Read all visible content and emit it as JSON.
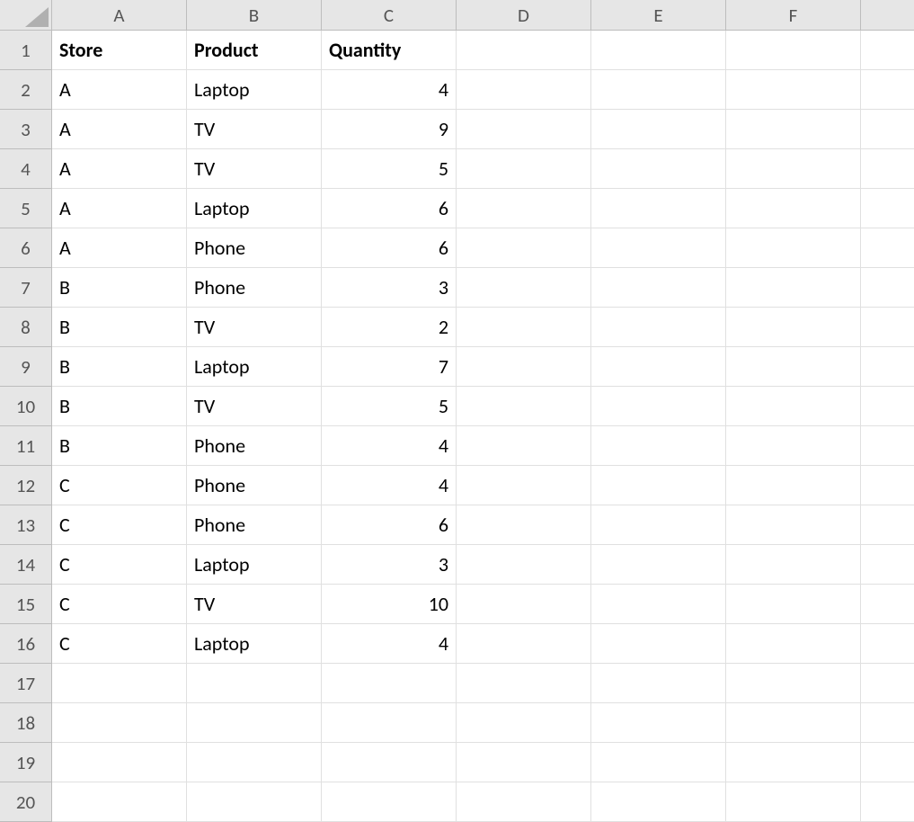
{
  "columns": [
    "A",
    "B",
    "C",
    "D",
    "E",
    "F",
    ""
  ],
  "rowCount": 20,
  "headers": {
    "A": "Store",
    "B": "Product",
    "C": "Quantity"
  },
  "rows": [
    {
      "store": "A",
      "product": "Laptop",
      "qty": "4"
    },
    {
      "store": "A",
      "product": "TV",
      "qty": "9"
    },
    {
      "store": "A",
      "product": "TV",
      "qty": "5"
    },
    {
      "store": "A",
      "product": "Laptop",
      "qty": "6"
    },
    {
      "store": "A",
      "product": "Phone",
      "qty": "6"
    },
    {
      "store": "B",
      "product": "Phone",
      "qty": "3"
    },
    {
      "store": "B",
      "product": "TV",
      "qty": "2"
    },
    {
      "store": "B",
      "product": "Laptop",
      "qty": "7"
    },
    {
      "store": "B",
      "product": "TV",
      "qty": "5"
    },
    {
      "store": "B",
      "product": "Phone",
      "qty": "4"
    },
    {
      "store": "C",
      "product": "Phone",
      "qty": "4"
    },
    {
      "store": "C",
      "product": "Phone",
      "qty": "6"
    },
    {
      "store": "C",
      "product": "Laptop",
      "qty": "3"
    },
    {
      "store": "C",
      "product": "TV",
      "qty": "10"
    },
    {
      "store": "C",
      "product": "Laptop",
      "qty": "4"
    }
  ]
}
